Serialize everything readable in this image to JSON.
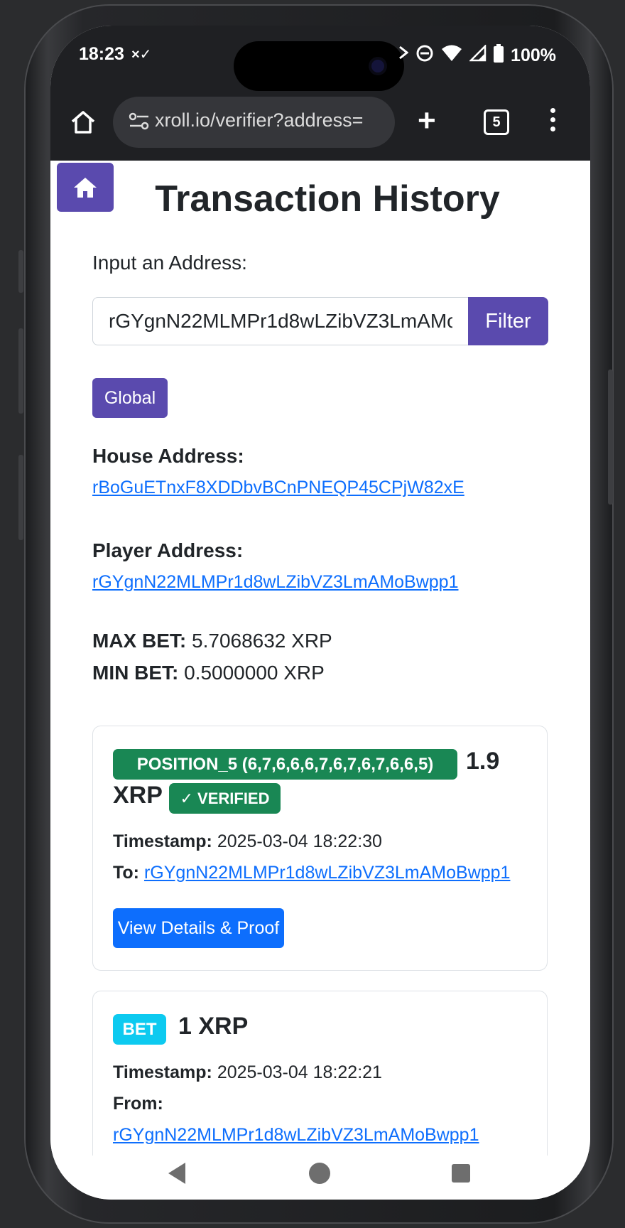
{
  "status_bar": {
    "time": "18:23",
    "sub_icon": "×✓",
    "battery": "100%"
  },
  "browser": {
    "url": "xroll.io/verifier?address=",
    "tab_count": "5"
  },
  "page": {
    "title": "Transaction History",
    "input_label": "Input an Address:",
    "address_value": "rGYgnN22MLMPr1d8wLZibVZ3LmAMoBwpp1",
    "filter_label": "Filter",
    "global_label": "Global",
    "house_label": "House Address:",
    "house_address": "rBoGuETnxF8XDDbvBCnPNEQP45CPjW82xE",
    "player_label": "Player Address:",
    "player_address": "rGYgnN22MLMPr1d8wLZibVZ3LmAMoBwpp1",
    "max_bet_label": "MAX BET:",
    "max_bet_value": "5.7068632 XRP",
    "min_bet_label": "MIN BET:",
    "min_bet_value": "0.5000000 XRP"
  },
  "transactions": [
    {
      "badge": "POSITION_5 (6,7,6,6,6,7,6,7,6,7,6,6,5)",
      "amount_line1": "1.9",
      "amount_line2": "XRP",
      "verified": "✓ VERIFIED",
      "timestamp_label": "Timestamp:",
      "timestamp": "2025-03-04 18:22:30",
      "to_label": "To:",
      "to_address": "rGYgnN22MLMPr1d8wLZibVZ3LmAMoBwpp1",
      "button": "View Details & Proof"
    },
    {
      "badge": "BET",
      "amount": "1 XRP",
      "timestamp_label": "Timestamp:",
      "timestamp": "2025-03-04 18:22:21",
      "from_label": "From:",
      "from_address": "rGYgnN22MLMPr1d8wLZibVZ3LmAMoBwpp1"
    }
  ],
  "colors": {
    "accent_purple": "#5a4aae",
    "link_blue": "#0d6efd",
    "success_green": "#198754",
    "info_cyan": "#0dcaf0"
  }
}
